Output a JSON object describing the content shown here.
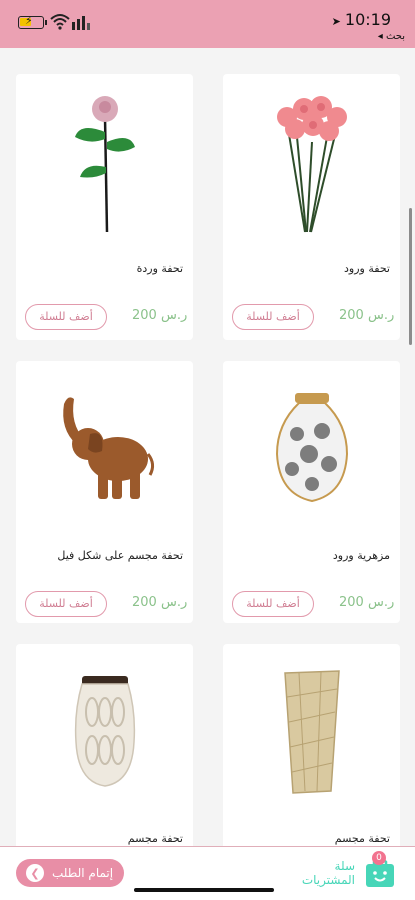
{
  "status_bar": {
    "time": "10:19",
    "back_label": "◂ بحث"
  },
  "products": [
    {
      "name": "تحفة وردة",
      "price": "200 ر.س",
      "add_label": "أضف للسلة",
      "image": "single-rose-icon"
    },
    {
      "name": "تحفة ورود",
      "price": "200 ر.س",
      "add_label": "أضف للسلة",
      "image": "rose-bouquet-icon"
    },
    {
      "name": "تحفة مجسم على شكل فيل",
      "price": "200 ر.س",
      "add_label": "أضف للسلة",
      "image": "elephant-figure-icon"
    },
    {
      "name": "مزهرية ورود",
      "price": "200 ر.س",
      "add_label": "أضف للسلة",
      "image": "floral-vase-icon"
    },
    {
      "name": "تحفة مجسم",
      "image": "white-vase-icon"
    },
    {
      "name": "تحفة مجسم",
      "image": "gold-vase-icon"
    }
  ],
  "bottom_bar": {
    "checkout_label": "إتمام الطلب",
    "cart_label_1": "سلة",
    "cart_label_2": "المشتريات",
    "cart_count": "0"
  },
  "colors": {
    "accent_pink": "#eba1b3",
    "price_green": "#8bc28b",
    "cart_teal": "#47d6b8"
  }
}
